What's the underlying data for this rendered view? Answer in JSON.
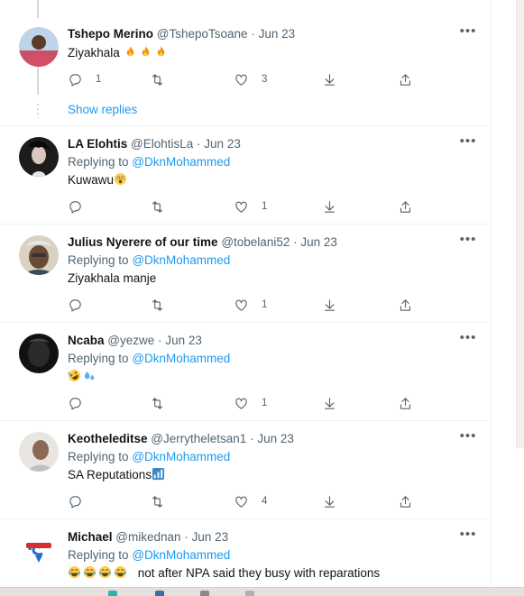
{
  "thread": {
    "show_replies_label": "Show replies",
    "tweets": [
      {
        "name": "Tshepo Merino",
        "handle": "@TshepoTsoane",
        "separator": "·",
        "date": "Jun 23",
        "replying_to_label": "",
        "replying_to_handle": "",
        "text": "Ziyakhala",
        "emojis": [
          "fire",
          "fire",
          "fire"
        ],
        "replies": "1",
        "retweets": "",
        "likes": "3"
      },
      {
        "name": "LA Elohtis",
        "handle": "@ElohtisLa",
        "separator": "·",
        "date": "Jun 23",
        "replying_to_label": "Replying to",
        "replying_to_handle": "@DknMohammed",
        "text": "Kuwawu",
        "emojis": [
          "astonished-face"
        ],
        "replies": "",
        "retweets": "",
        "likes": "1"
      },
      {
        "name": "Julius Nyerere of our time",
        "handle": "@tobelani52",
        "separator": "·",
        "date": "Jun 23",
        "replying_to_label": "Replying to",
        "replying_to_handle": "@DknMohammed",
        "text": "Ziyakhala manje",
        "emojis": [],
        "replies": "",
        "retweets": "",
        "likes": "1"
      },
      {
        "name": "Ncaba",
        "handle": "@yezwe",
        "separator": "·",
        "date": "Jun 23",
        "replying_to_label": "Replying to",
        "replying_to_handle": "@DknMohammed",
        "text": "",
        "emojis": [
          "rolling-on-floor-laughing",
          "sweat-droplets"
        ],
        "replies": "",
        "retweets": "",
        "likes": "1"
      },
      {
        "name": "Keotheleditse",
        "handle": "@Jerrytheletsan1",
        "separator": "·",
        "date": "Jun 23",
        "replying_to_label": "Replying to",
        "replying_to_handle": "@DknMohammed",
        "text": "SA Reputations",
        "emojis": [
          "chart-increasing"
        ],
        "replies": "",
        "retweets": "",
        "likes": "4"
      },
      {
        "name": "Michael",
        "handle": "@mikednan",
        "separator": "·",
        "date": "Jun 23",
        "replying_to_label": "Replying to",
        "replying_to_handle": "@DknMohammed",
        "text": "not after NPA said they busy with reparations",
        "emojis": [
          "tears-of-joy",
          "tears-of-joy",
          "tears-of-joy",
          "tears-of-joy"
        ],
        "replies": "",
        "retweets": "",
        "likes": ""
      }
    ]
  },
  "icons": {
    "more": "more-options-icon",
    "reply": "reply-icon",
    "retweet": "retweet-icon",
    "like": "like-icon",
    "download": "download-icon",
    "share": "share-icon"
  },
  "colors": {
    "link": "#1d9bf0",
    "muted": "#536471",
    "text": "#0f1419",
    "divider": "#eff3f4"
  }
}
